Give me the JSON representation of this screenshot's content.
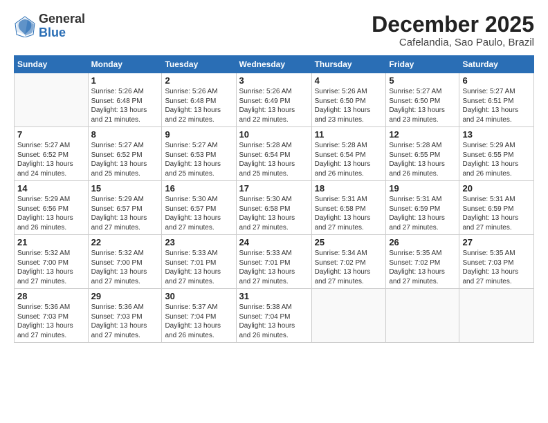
{
  "header": {
    "logo_general": "General",
    "logo_blue": "Blue",
    "month_title": "December 2025",
    "location": "Cafelandia, Sao Paulo, Brazil"
  },
  "weekdays": [
    "Sunday",
    "Monday",
    "Tuesday",
    "Wednesday",
    "Thursday",
    "Friday",
    "Saturday"
  ],
  "weeks": [
    [
      {
        "day": "",
        "sunrise": "",
        "sunset": "",
        "daylight": ""
      },
      {
        "day": "1",
        "sunrise": "Sunrise: 5:26 AM",
        "sunset": "Sunset: 6:48 PM",
        "daylight": "Daylight: 13 hours and 21 minutes."
      },
      {
        "day": "2",
        "sunrise": "Sunrise: 5:26 AM",
        "sunset": "Sunset: 6:48 PM",
        "daylight": "Daylight: 13 hours and 22 minutes."
      },
      {
        "day": "3",
        "sunrise": "Sunrise: 5:26 AM",
        "sunset": "Sunset: 6:49 PM",
        "daylight": "Daylight: 13 hours and 22 minutes."
      },
      {
        "day": "4",
        "sunrise": "Sunrise: 5:26 AM",
        "sunset": "Sunset: 6:50 PM",
        "daylight": "Daylight: 13 hours and 23 minutes."
      },
      {
        "day": "5",
        "sunrise": "Sunrise: 5:27 AM",
        "sunset": "Sunset: 6:50 PM",
        "daylight": "Daylight: 13 hours and 23 minutes."
      },
      {
        "day": "6",
        "sunrise": "Sunrise: 5:27 AM",
        "sunset": "Sunset: 6:51 PM",
        "daylight": "Daylight: 13 hours and 24 minutes."
      }
    ],
    [
      {
        "day": "7",
        "sunrise": "Sunrise: 5:27 AM",
        "sunset": "Sunset: 6:52 PM",
        "daylight": "Daylight: 13 hours and 24 minutes."
      },
      {
        "day": "8",
        "sunrise": "Sunrise: 5:27 AM",
        "sunset": "Sunset: 6:52 PM",
        "daylight": "Daylight: 13 hours and 25 minutes."
      },
      {
        "day": "9",
        "sunrise": "Sunrise: 5:27 AM",
        "sunset": "Sunset: 6:53 PM",
        "daylight": "Daylight: 13 hours and 25 minutes."
      },
      {
        "day": "10",
        "sunrise": "Sunrise: 5:28 AM",
        "sunset": "Sunset: 6:54 PM",
        "daylight": "Daylight: 13 hours and 25 minutes."
      },
      {
        "day": "11",
        "sunrise": "Sunrise: 5:28 AM",
        "sunset": "Sunset: 6:54 PM",
        "daylight": "Daylight: 13 hours and 26 minutes."
      },
      {
        "day": "12",
        "sunrise": "Sunrise: 5:28 AM",
        "sunset": "Sunset: 6:55 PM",
        "daylight": "Daylight: 13 hours and 26 minutes."
      },
      {
        "day": "13",
        "sunrise": "Sunrise: 5:29 AM",
        "sunset": "Sunset: 6:55 PM",
        "daylight": "Daylight: 13 hours and 26 minutes."
      }
    ],
    [
      {
        "day": "14",
        "sunrise": "Sunrise: 5:29 AM",
        "sunset": "Sunset: 6:56 PM",
        "daylight": "Daylight: 13 hours and 26 minutes."
      },
      {
        "day": "15",
        "sunrise": "Sunrise: 5:29 AM",
        "sunset": "Sunset: 6:57 PM",
        "daylight": "Daylight: 13 hours and 27 minutes."
      },
      {
        "day": "16",
        "sunrise": "Sunrise: 5:30 AM",
        "sunset": "Sunset: 6:57 PM",
        "daylight": "Daylight: 13 hours and 27 minutes."
      },
      {
        "day": "17",
        "sunrise": "Sunrise: 5:30 AM",
        "sunset": "Sunset: 6:58 PM",
        "daylight": "Daylight: 13 hours and 27 minutes."
      },
      {
        "day": "18",
        "sunrise": "Sunrise: 5:31 AM",
        "sunset": "Sunset: 6:58 PM",
        "daylight": "Daylight: 13 hours and 27 minutes."
      },
      {
        "day": "19",
        "sunrise": "Sunrise: 5:31 AM",
        "sunset": "Sunset: 6:59 PM",
        "daylight": "Daylight: 13 hours and 27 minutes."
      },
      {
        "day": "20",
        "sunrise": "Sunrise: 5:31 AM",
        "sunset": "Sunset: 6:59 PM",
        "daylight": "Daylight: 13 hours and 27 minutes."
      }
    ],
    [
      {
        "day": "21",
        "sunrise": "Sunrise: 5:32 AM",
        "sunset": "Sunset: 7:00 PM",
        "daylight": "Daylight: 13 hours and 27 minutes."
      },
      {
        "day": "22",
        "sunrise": "Sunrise: 5:32 AM",
        "sunset": "Sunset: 7:00 PM",
        "daylight": "Daylight: 13 hours and 27 minutes."
      },
      {
        "day": "23",
        "sunrise": "Sunrise: 5:33 AM",
        "sunset": "Sunset: 7:01 PM",
        "daylight": "Daylight: 13 hours and 27 minutes."
      },
      {
        "day": "24",
        "sunrise": "Sunrise: 5:33 AM",
        "sunset": "Sunset: 7:01 PM",
        "daylight": "Daylight: 13 hours and 27 minutes."
      },
      {
        "day": "25",
        "sunrise": "Sunrise: 5:34 AM",
        "sunset": "Sunset: 7:02 PM",
        "daylight": "Daylight: 13 hours and 27 minutes."
      },
      {
        "day": "26",
        "sunrise": "Sunrise: 5:35 AM",
        "sunset": "Sunset: 7:02 PM",
        "daylight": "Daylight: 13 hours and 27 minutes."
      },
      {
        "day": "27",
        "sunrise": "Sunrise: 5:35 AM",
        "sunset": "Sunset: 7:03 PM",
        "daylight": "Daylight: 13 hours and 27 minutes."
      }
    ],
    [
      {
        "day": "28",
        "sunrise": "Sunrise: 5:36 AM",
        "sunset": "Sunset: 7:03 PM",
        "daylight": "Daylight: 13 hours and 27 minutes."
      },
      {
        "day": "29",
        "sunrise": "Sunrise: 5:36 AM",
        "sunset": "Sunset: 7:03 PM",
        "daylight": "Daylight: 13 hours and 27 minutes."
      },
      {
        "day": "30",
        "sunrise": "Sunrise: 5:37 AM",
        "sunset": "Sunset: 7:04 PM",
        "daylight": "Daylight: 13 hours and 26 minutes."
      },
      {
        "day": "31",
        "sunrise": "Sunrise: 5:38 AM",
        "sunset": "Sunset: 7:04 PM",
        "daylight": "Daylight: 13 hours and 26 minutes."
      },
      {
        "day": "",
        "sunrise": "",
        "sunset": "",
        "daylight": ""
      },
      {
        "day": "",
        "sunrise": "",
        "sunset": "",
        "daylight": ""
      },
      {
        "day": "",
        "sunrise": "",
        "sunset": "",
        "daylight": ""
      }
    ]
  ]
}
